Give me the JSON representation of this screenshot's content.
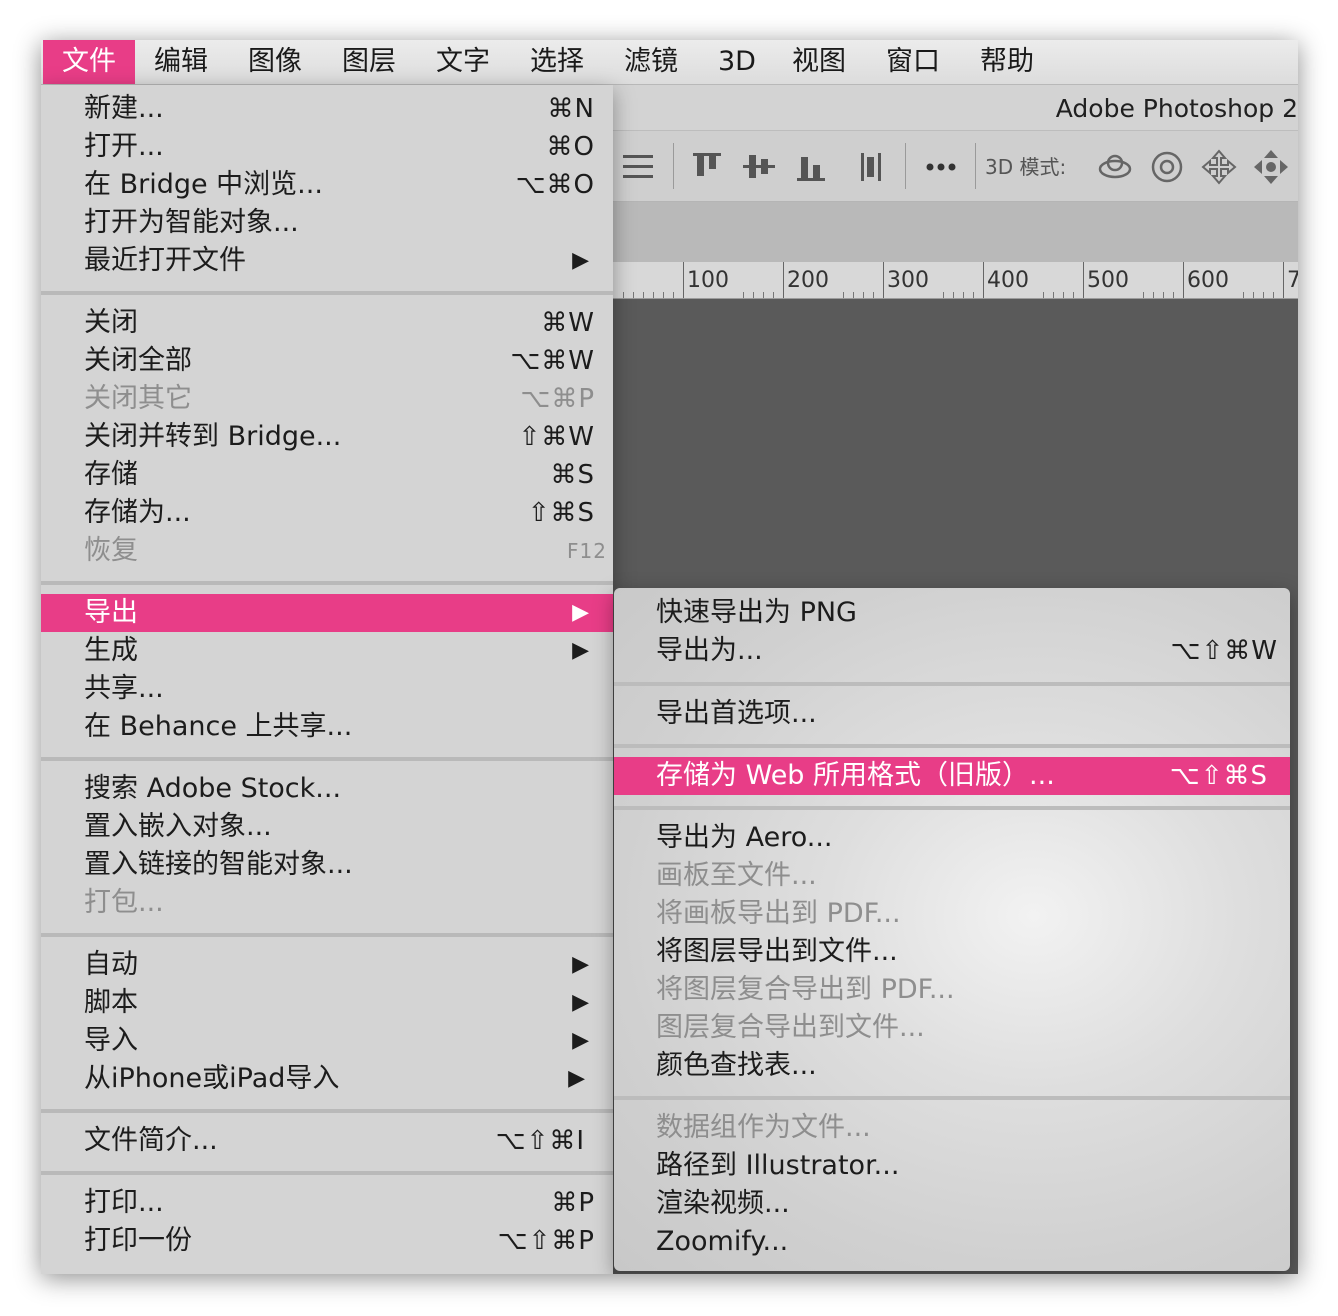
{
  "menubar": {
    "items": [
      "文件",
      "编辑",
      "图像",
      "图层",
      "文字",
      "选择",
      "滤镜",
      "3D",
      "视图",
      "窗口",
      "帮助"
    ]
  },
  "app": {
    "title": "Adobe Photoshop 2",
    "mode_label": "3D 模式:",
    "ruler_labels": [
      "100",
      "200",
      "300",
      "400",
      "500",
      "600",
      "7"
    ]
  },
  "file_menu": {
    "items": [
      {
        "label": "新建...",
        "shortcut": "⌘N"
      },
      {
        "label": "打开...",
        "shortcut": "⌘O"
      },
      {
        "label": "在 Bridge 中浏览...",
        "shortcut": "⌥⌘O"
      },
      {
        "label": "打开为智能对象...",
        "shortcut": ""
      },
      {
        "label": "最近打开文件",
        "shortcut": "▶"
      },
      {
        "label": "关闭",
        "shortcut": "⌘W"
      },
      {
        "label": "关闭全部",
        "shortcut": "⌥⌘W"
      },
      {
        "label": "关闭其它",
        "shortcut": "⌥⌘P"
      },
      {
        "label": "关闭并转到 Bridge...",
        "shortcut": "⇧⌘W"
      },
      {
        "label": "存储",
        "shortcut": "⌘S"
      },
      {
        "label": "存储为...",
        "shortcut": "⇧⌘S"
      },
      {
        "label": "恢复",
        "shortcut": "F12"
      },
      {
        "label": "导出",
        "shortcut": "▶"
      },
      {
        "label": "生成",
        "shortcut": "▶"
      },
      {
        "label": "共享...",
        "shortcut": ""
      },
      {
        "label": "在 Behance 上共享...",
        "shortcut": ""
      },
      {
        "label": "搜索 Adobe Stock...",
        "shortcut": ""
      },
      {
        "label": "置入嵌入对象...",
        "shortcut": ""
      },
      {
        "label": "置入链接的智能对象...",
        "shortcut": ""
      },
      {
        "label": "打包...",
        "shortcut": ""
      },
      {
        "label": "自动",
        "shortcut": "▶"
      },
      {
        "label": "脚本",
        "shortcut": "▶"
      },
      {
        "label": "导入",
        "shortcut": "▶"
      },
      {
        "label": "从iPhone或iPad导入",
        "shortcut": "▶"
      },
      {
        "label": "文件简介...",
        "shortcut": "⌥⇧⌘I"
      },
      {
        "label": "打印...",
        "shortcut": "⌘P"
      },
      {
        "label": "打印一份",
        "shortcut": "⌥⇧⌘P"
      }
    ]
  },
  "export_menu": {
    "items": [
      {
        "label": "快速导出为 PNG",
        "shortcut": ""
      },
      {
        "label": "导出为...",
        "shortcut": "⌥⇧⌘W"
      },
      {
        "label": "导出首选项...",
        "shortcut": ""
      },
      {
        "label": "存储为 Web 所用格式（旧版）...",
        "shortcut": "⌥⇧⌘S"
      },
      {
        "label": "导出为 Aero...",
        "shortcut": ""
      },
      {
        "label": "画板至文件...",
        "shortcut": ""
      },
      {
        "label": "将画板导出到 PDF...",
        "shortcut": ""
      },
      {
        "label": "将图层导出到文件...",
        "shortcut": ""
      },
      {
        "label": "将图层复合导出到 PDF...",
        "shortcut": ""
      },
      {
        "label": "图层复合导出到文件...",
        "shortcut": ""
      },
      {
        "label": "颜色查找表...",
        "shortcut": ""
      },
      {
        "label": "数据组作为文件...",
        "shortcut": ""
      },
      {
        "label": "路径到 Illustrator...",
        "shortcut": ""
      },
      {
        "label": "渲染视频...",
        "shortcut": ""
      },
      {
        "label": "Zoomify...",
        "shortcut": ""
      }
    ]
  },
  "colors": {
    "accent": "#e83d87",
    "disabled_text": "#8e8e8e",
    "menu_bg": "#d8d8d8",
    "workspace": "#5a5a5a"
  }
}
